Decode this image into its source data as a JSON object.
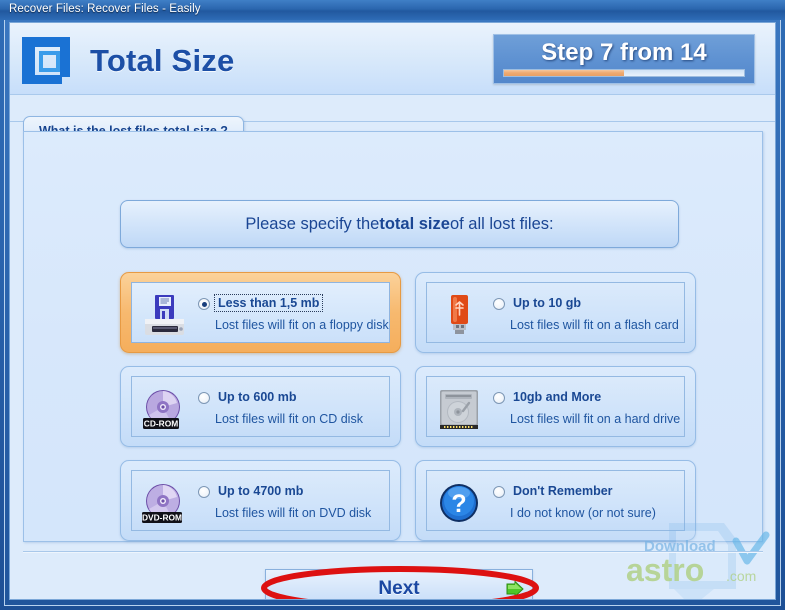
{
  "window": {
    "title": "Recover Files: Recover Files - Easily"
  },
  "header": {
    "page_title": "Total Size",
    "logo_icon": "square-frame-logo-icon",
    "step": {
      "label": "Step 7 from 14",
      "current": 7,
      "total": 14,
      "progress_percent": 50,
      "fill_color": "#eca468",
      "badge_color": "#5f92d2"
    }
  },
  "question_tab": {
    "label": "What is the lost files total size ?"
  },
  "prompt": {
    "prefix": "Please specify the ",
    "emphasis": "total size",
    "suffix": " of all lost files:"
  },
  "options": [
    {
      "id": "less-than-1-5-mb",
      "title": "Less than 1,5 mb",
      "subtitle": "Lost files will fit on a floppy disk",
      "icon": "floppy-disk-drive-icon",
      "selected": true,
      "focused": true
    },
    {
      "id": "up-to-10-gb",
      "title": "Up to 10 gb",
      "subtitle": "Lost files will fit on a flash card",
      "icon": "usb-flash-drive-icon",
      "selected": false,
      "focused": false
    },
    {
      "id": "up-to-600-mb",
      "title": "Up to 600 mb",
      "subtitle": "Lost files will fit on CD disk",
      "icon": "cd-rom-disc-icon",
      "icon_badge": "CD-ROM",
      "selected": false,
      "focused": false
    },
    {
      "id": "10gb-and-more",
      "title": "10gb and More",
      "subtitle": "Lost files will fit on a hard drive",
      "icon": "hard-drive-icon",
      "selected": false,
      "focused": false
    },
    {
      "id": "up-to-4700-mb",
      "title": "Up to 4700 mb",
      "subtitle": "Lost files will fit on DVD disk",
      "icon": "dvd-rom-disc-icon",
      "icon_badge": "DVD-ROM",
      "selected": false,
      "focused": false
    },
    {
      "id": "dont-remember",
      "title": "Don't Remember",
      "subtitle": "I do not know (or not sure)",
      "icon": "question-mark-circle-icon",
      "selected": false,
      "focused": false
    }
  ],
  "footer": {
    "next_label": "Next",
    "next_arrow_icon": "green-arrow-right-icon",
    "highlight_annotation": {
      "shape": "ellipse",
      "color": "#dd1111"
    }
  },
  "watermark": {
    "line1": "Download",
    "line2": "astro",
    "line3": ".com",
    "check_icon": "check-mark-icon"
  }
}
